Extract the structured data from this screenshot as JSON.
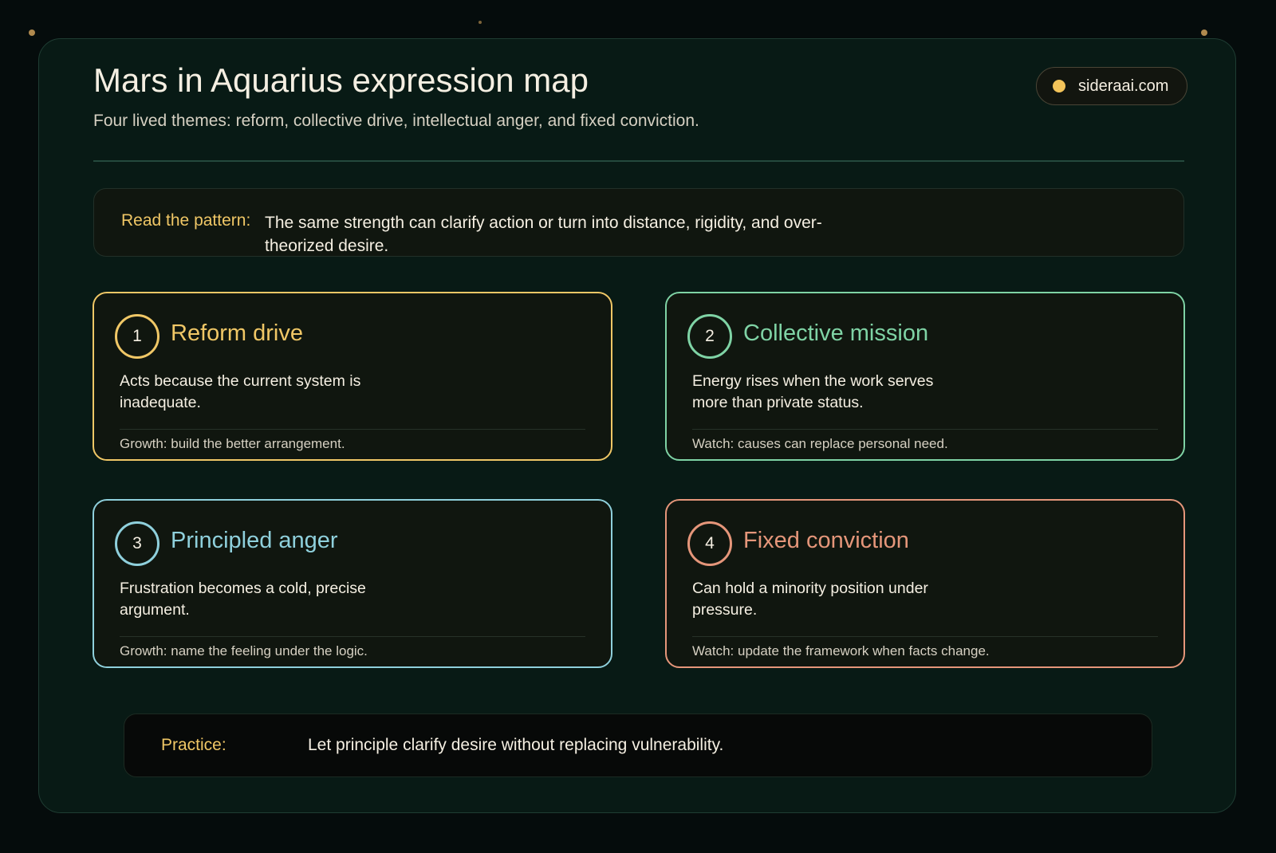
{
  "header": {
    "title": "Mars in Aquarius expression map",
    "subtitle": "Four lived themes: reform, collective drive, intellectual anger, and fixed conviction.",
    "brand": "sideraai.com"
  },
  "pattern": {
    "label": "Read the pattern:",
    "text": "The same strength can clarify action or turn into distance, rigidity, and over-theorized desire."
  },
  "cards": [
    {
      "number": "1",
      "title": "Reform drive",
      "body": "Acts because the current system is inadequate.",
      "note": "Growth: build the better arrangement.",
      "color": "#f0c766"
    },
    {
      "number": "2",
      "title": "Collective mission",
      "body": "Energy rises when the work serves more than private status.",
      "note": "Watch: causes can replace personal need.",
      "color": "#7fd3a5"
    },
    {
      "number": "3",
      "title": "Principled anger",
      "body": "Frustration becomes a cold, precise argument.",
      "note": "Growth: name the feeling under the logic.",
      "color": "#8fd0dc"
    },
    {
      "number": "4",
      "title": "Fixed conviction",
      "body": "Can hold a minority position under pressure.",
      "note": "Watch: update the framework when facts change.",
      "color": "#e5967a"
    }
  ],
  "practice": {
    "label": "Practice:",
    "text": "Let principle clarify desire without replacing vulnerability."
  },
  "colors": {
    "background": "#050c0c",
    "panel": "#081a15",
    "accent_gold": "#f0c766",
    "accent_green": "#7fd3a5",
    "accent_cyan": "#8fd0dc",
    "accent_coral": "#e5967a"
  }
}
